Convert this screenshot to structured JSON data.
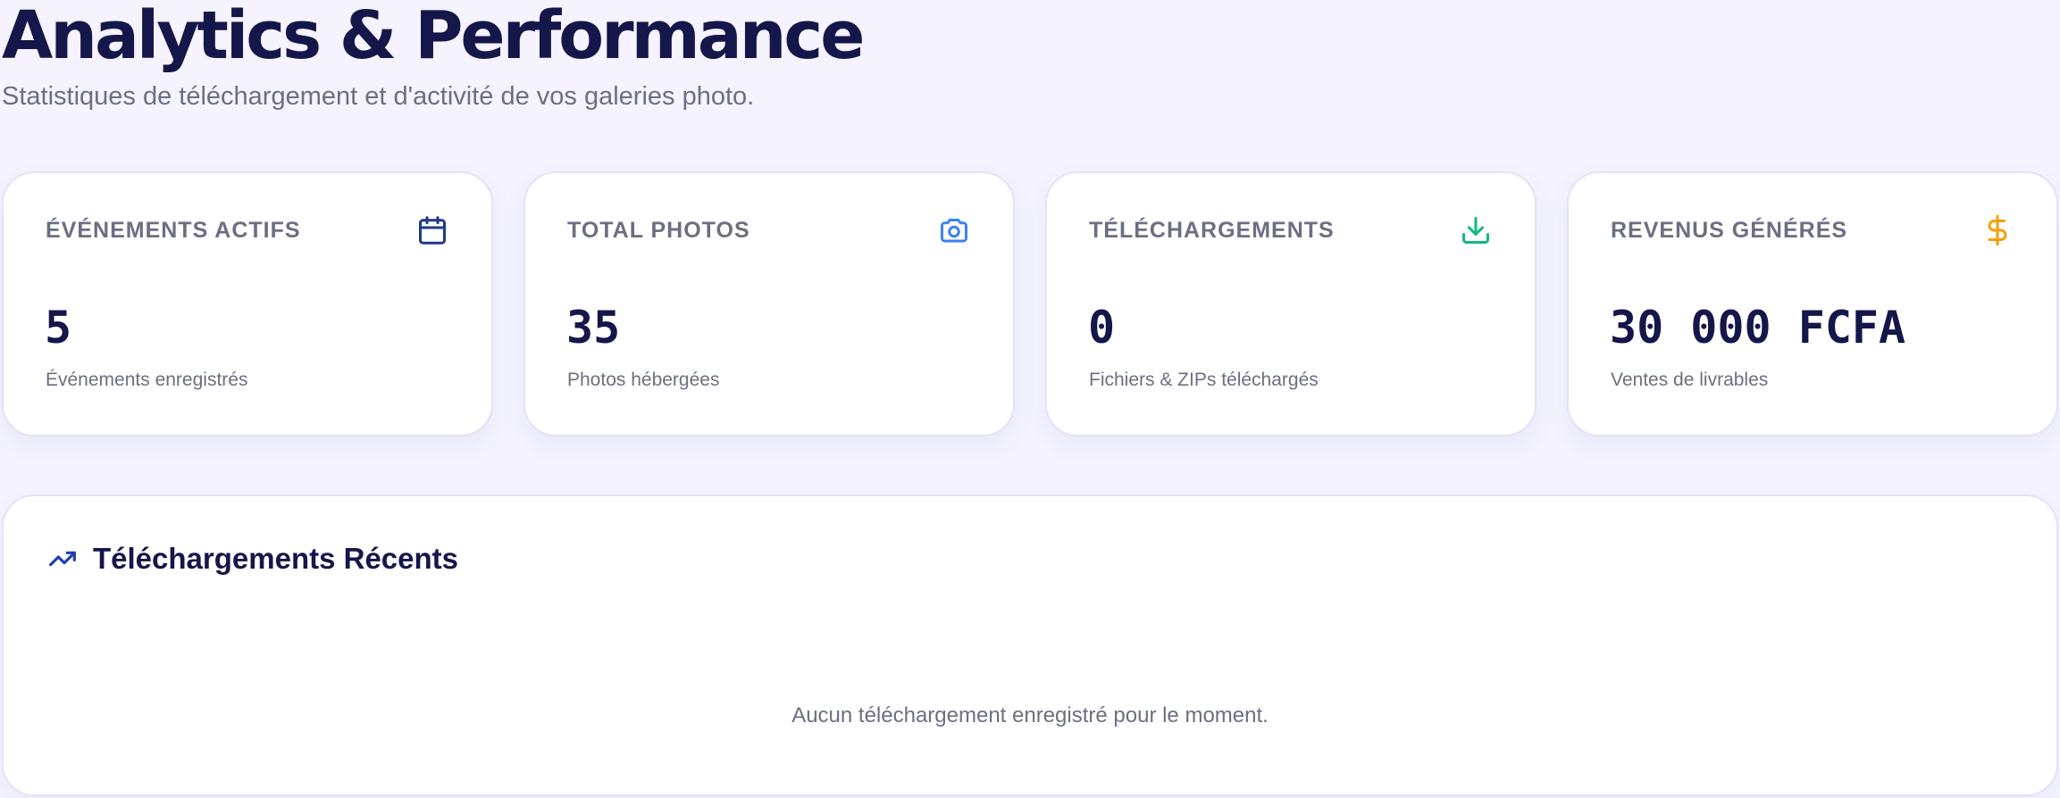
{
  "header": {
    "title": "Analytics & Performance",
    "subtitle": "Statistiques de téléchargement et d'activité de vos galeries photo."
  },
  "stats": [
    {
      "label": "ÉVÉNEMENTS ACTIFS",
      "value": "5",
      "caption": "Événements enregistrés",
      "icon": "calendar-icon",
      "icon_color": "#1e3a8a"
    },
    {
      "label": "TOTAL PHOTOS",
      "value": "35",
      "caption": "Photos hébergées",
      "icon": "camera-icon",
      "icon_color": "#3b82f6"
    },
    {
      "label": "TÉLÉCHARGEMENTS",
      "value": "0",
      "caption": "Fichiers & ZIPs téléchargés",
      "icon": "download-icon",
      "icon_color": "#10b981"
    },
    {
      "label": "REVENUS GÉNÉRÉS",
      "value": "30 000 FCFA",
      "caption": "Ventes de livrables",
      "icon": "dollar-icon",
      "icon_color": "#f59e0b"
    }
  ],
  "recent": {
    "title": "Téléchargements Récents",
    "icon": "trending-up-icon",
    "icon_color": "#1e40af",
    "empty_message": "Aucun téléchargement enregistré pour le moment."
  },
  "colors": {
    "background": "#f4f3fe",
    "text_primary": "#15164a",
    "text_muted": "#6b6f82",
    "card_border": "#e4e2f7"
  }
}
